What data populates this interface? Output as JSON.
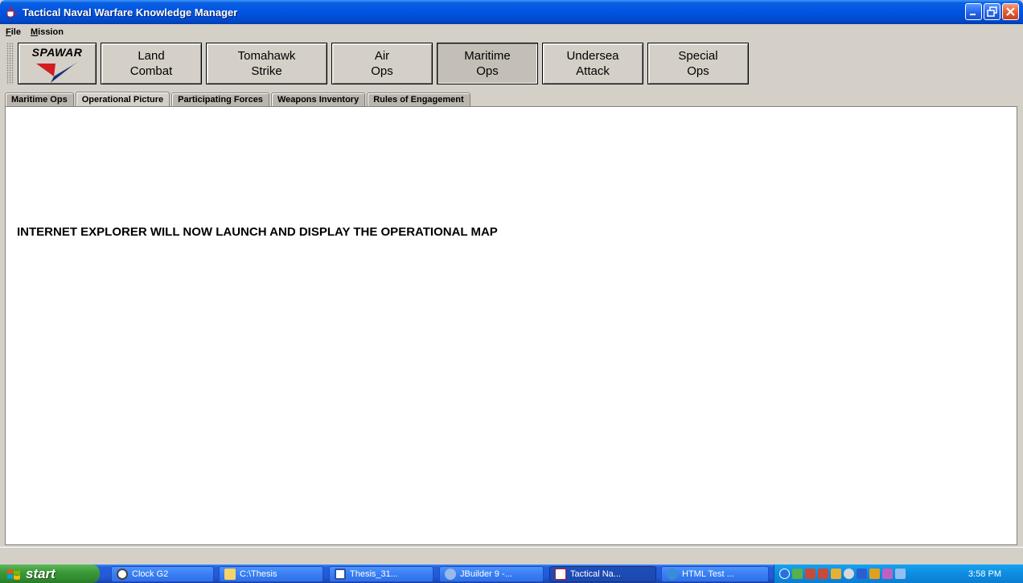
{
  "window": {
    "title": "Tactical Naval Warfare Knowledge Manager"
  },
  "menu": {
    "file": "File",
    "mission": "Mission"
  },
  "toolbar": {
    "logo_text": "SPAWAR",
    "buttons": [
      {
        "line1": "Land",
        "line2": "Combat"
      },
      {
        "line1": "Tomahawk",
        "line2": "Strike"
      },
      {
        "line1": "Air",
        "line2": "Ops"
      },
      {
        "line1": "Maritime",
        "line2": "Ops",
        "pressed": true
      },
      {
        "line1": "Undersea",
        "line2": "Attack"
      },
      {
        "line1": "Special",
        "line2": "Ops"
      }
    ]
  },
  "tabs": [
    {
      "label": "Maritime Ops"
    },
    {
      "label": "Operational Picture",
      "active": true
    },
    {
      "label": "Participating Forces"
    },
    {
      "label": "Weapons Inventory"
    },
    {
      "label": "Rules of Engagement"
    }
  ],
  "content": {
    "message": "INTERNET EXPLORER WILL NOW LAUNCH AND DISPLAY THE OPERATIONAL MAP"
  },
  "taskbar": {
    "start_label": "start",
    "tasks": [
      {
        "label": "Clock G2"
      },
      {
        "label": "C:\\Thesis"
      },
      {
        "label": "Thesis_31..."
      },
      {
        "label": "JBuilder 9 -..."
      },
      {
        "label": "Tactical Na...",
        "active": true
      },
      {
        "label": "HTML Test ..."
      }
    ],
    "clock": "3:58 PM"
  },
  "colors": {
    "title_bar": "#0054e3",
    "window_face": "#d4d0c8",
    "content_bg": "#ffffff",
    "start_green": "#3c9a3a",
    "tray_blue": "#0e8ce0"
  }
}
